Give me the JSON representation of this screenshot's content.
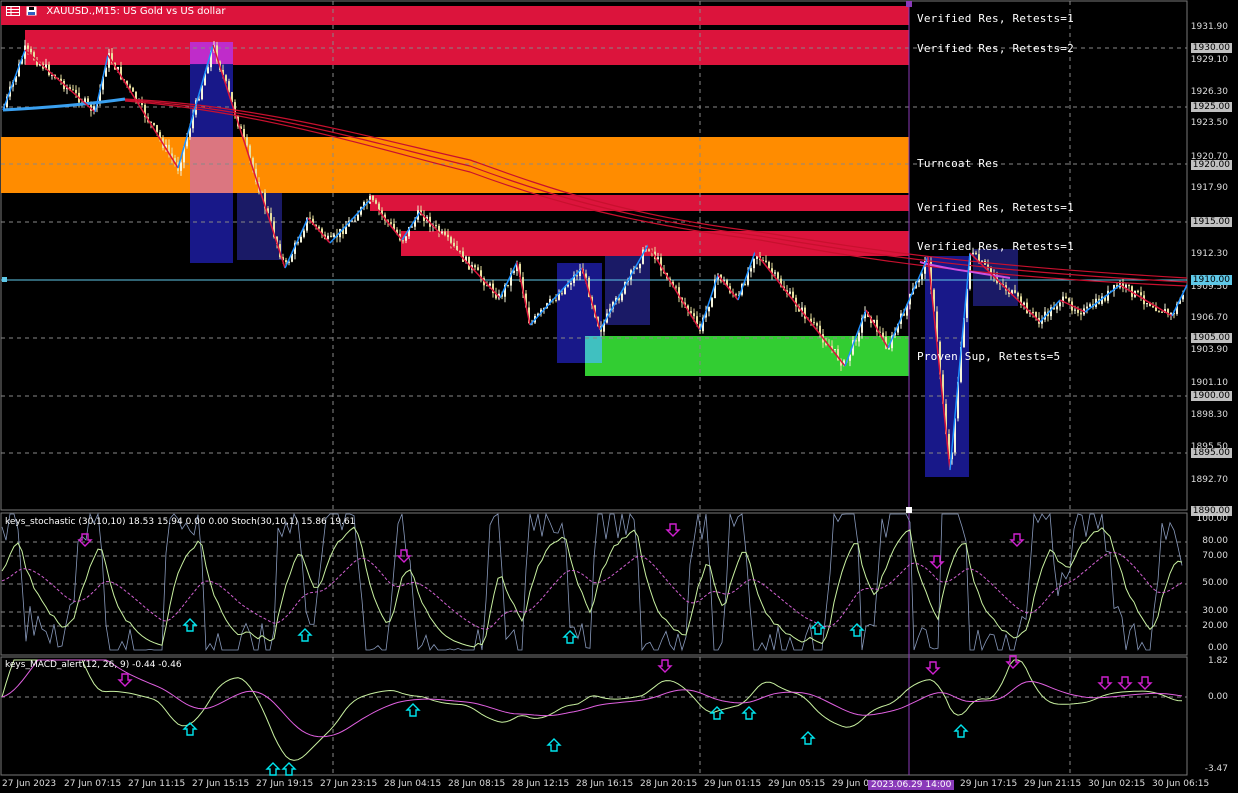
{
  "window": {
    "symbol_title": "XAUUSD.,M15:  US Gold vs US dollar",
    "chart_icon": "chart-grid-icon",
    "save_icon": "floppy-icon"
  },
  "zones": [
    {
      "label": "Verified Res, Retests=1",
      "color": "#dc143c"
    },
    {
      "label": "Verified Res, Retests=2",
      "color": "#dc143c"
    },
    {
      "label": "Turncoat Res",
      "color": "#ff8c00"
    },
    {
      "label": "Verified Res, Retests=1",
      "color": "#dc143c"
    },
    {
      "label": "Verified Res, Retests=1",
      "color": "#dc143c"
    },
    {
      "label": "Proven Sup, Retests=5",
      "color": "#32cd32"
    }
  ],
  "price_axis": {
    "ticks": [
      "1931.90",
      "1929.10",
      "1926.30",
      "1923.50",
      "1920.70",
      "1917.90",
      "1912.30",
      "1909.50",
      "1906.70",
      "1903.90",
      "1901.10",
      "1898.30",
      "1895.50",
      "1892.70"
    ],
    "boxed": [
      "1930.00",
      "1925.00",
      "1920.00",
      "1915.00",
      "1910.00",
      "1905.00",
      "1900.00",
      "1895.00",
      "1890.00"
    ]
  },
  "stochastic": {
    "title": "keys_stochastic (30,10,10) 18.53 15.94 0.00 0.00  Stoch(30,10,1) 15.86 19.61",
    "ticks": [
      "100.00",
      "80.00",
      "70.00",
      "50.00",
      "30.00",
      "20.00",
      "0.00"
    ]
  },
  "macd": {
    "title": "keys_MACD_alert(12, 26, 9) -0.44 -0.46",
    "ticks": [
      "1.82",
      "0.00",
      "-3.47"
    ]
  },
  "time_axis": {
    "ticks": [
      "27 Jun 2023",
      "27 Jun 07:15",
      "27 Jun 11:15",
      "27 Jun 15:15",
      "27 Jun 19:15",
      "27 Jun 23:15",
      "28 Jun 04:15",
      "28 Jun 08:15",
      "28 Jun 12:15",
      "28 Jun 16:15",
      "28 Jun 20:15",
      "29 Jun 01:15",
      "29 Jun 05:15",
      "29 Jun 0",
      "29 Jun 17:15",
      "29 Jun 21:15",
      "30 Jun 02:15",
      "30 Jun 06:15"
    ],
    "cursor_label": "2023.06.29 14:00"
  },
  "colors": {
    "resistance": "#dc143c",
    "turncoat": "#ff8c00",
    "support": "#32cd32",
    "bull_box": "#191970",
    "candle": "#f5f5dc",
    "ma_red": "#c8102e",
    "zigzag_blue": "#1e90ff",
    "arrow_magenta": "#d020d0",
    "arrow_cyan": "#00e5ee",
    "cursor": "#8a3ab9"
  }
}
